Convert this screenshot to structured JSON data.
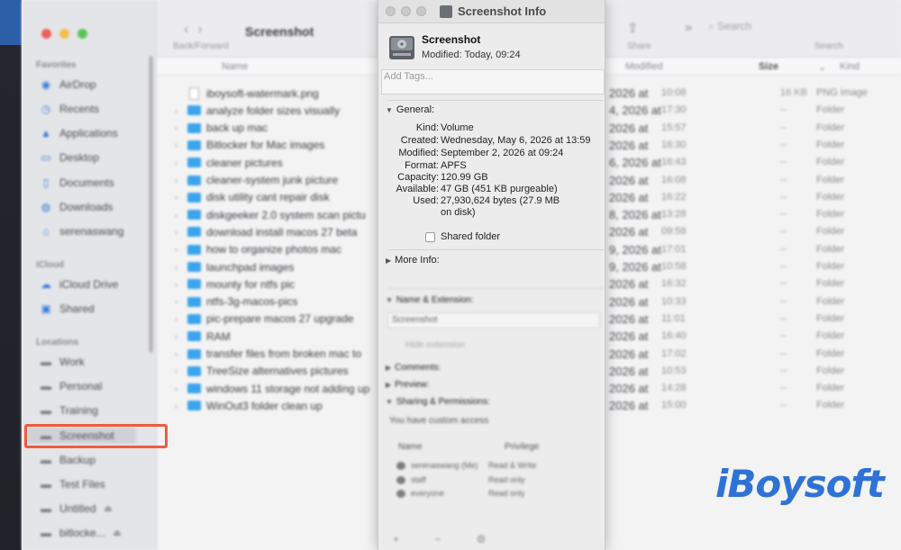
{
  "finder": {
    "sidebar": {
      "sections": [
        "Favorites",
        "iCloud",
        "Locations"
      ],
      "favorites": [
        "AirDrop",
        "Recents",
        "Applications",
        "Desktop",
        "Documents",
        "Downloads",
        "serenaswang"
      ],
      "icloud": [
        "iCloud Drive",
        "Shared"
      ],
      "locations": [
        "Work",
        "Personal",
        "Training",
        "Screenshot",
        "Backup",
        "Test Files",
        "Untitled",
        "bitlocke..."
      ]
    },
    "toolbar": {
      "title": "Screenshot",
      "back_forward_caption": "Back/Forward",
      "share_caption": "Share",
      "search_placeholder": "Search",
      "search_caption": "Search"
    },
    "columns": {
      "name": "Name",
      "modified": "Modified",
      "size": "Size",
      "kind": "Kind"
    },
    "files": [
      {
        "name": "iboysoft-watermark.png",
        "type": "file",
        "date": "2026 at",
        "time": "10:08",
        "size": "16 KB",
        "kind": "PNG image"
      },
      {
        "name": "analyze folder sizes visually",
        "type": "folder",
        "date": "4, 2026 at",
        "time": "17:30",
        "size": "--",
        "kind": "Folder"
      },
      {
        "name": "back up mac",
        "type": "folder",
        "date": "2026 at",
        "time": "15:57",
        "size": "--",
        "kind": "Folder"
      },
      {
        "name": "Bitlocker for Mac images",
        "type": "folder",
        "date": "2026 at",
        "time": "16:30",
        "size": "--",
        "kind": "Folder"
      },
      {
        "name": "cleaner pictures",
        "type": "folder",
        "date": "6, 2026 at",
        "time": "16:43",
        "size": "--",
        "kind": "Folder"
      },
      {
        "name": "cleaner-system junk picture",
        "type": "folder",
        "date": "2026 at",
        "time": "16:08",
        "size": "--",
        "kind": "Folder"
      },
      {
        "name": "disk utility cant repair disk",
        "type": "folder",
        "date": "2026 at",
        "time": "16:22",
        "size": "--",
        "kind": "Folder"
      },
      {
        "name": "diskgeeker 2.0 system scan pictu",
        "type": "folder",
        "date": "8, 2026 at",
        "time": "13:28",
        "size": "--",
        "kind": "Folder"
      },
      {
        "name": "download install macos 27 beta",
        "type": "folder",
        "date": "2026 at",
        "time": "09:58",
        "size": "--",
        "kind": "Folder"
      },
      {
        "name": "how to organize photos mac",
        "type": "folder",
        "date": "9, 2026 at",
        "time": "17:01",
        "size": "--",
        "kind": "Folder"
      },
      {
        "name": "launchpad images",
        "type": "folder",
        "date": "9, 2026 at",
        "time": "10:58",
        "size": "--",
        "kind": "Folder"
      },
      {
        "name": "mounty for ntfs pic",
        "type": "folder",
        "date": "2026 at",
        "time": "16:32",
        "size": "--",
        "kind": "Folder"
      },
      {
        "name": "ntfs-3g-macos-pics",
        "type": "folder",
        "date": "2026 at",
        "time": "10:33",
        "size": "--",
        "kind": "Folder"
      },
      {
        "name": "pic-prepare macos 27 upgrade",
        "type": "folder",
        "date": "2026 at",
        "time": "11:01",
        "size": "--",
        "kind": "Folder"
      },
      {
        "name": "RAM",
        "type": "folder",
        "date": "2026 at",
        "time": "16:40",
        "size": "--",
        "kind": "Folder"
      },
      {
        "name": "transfer files from broken mac to",
        "type": "folder",
        "date": "2026 at",
        "time": "17:02",
        "size": "--",
        "kind": "Folder"
      },
      {
        "name": "TreeSize alternatives pictures",
        "type": "folder",
        "date": "2026 at",
        "time": "10:53",
        "size": "--",
        "kind": "Folder"
      },
      {
        "name": "windows 11 storage not adding up",
        "type": "folder",
        "date": "2026 at",
        "time": "14:28",
        "size": "--",
        "kind": "Folder"
      },
      {
        "name": "WinOut3 folder clean up",
        "type": "folder",
        "date": "2026 at",
        "time": "15:00",
        "size": "--",
        "kind": "Folder"
      }
    ]
  },
  "info": {
    "window_title": "Screenshot Info",
    "name": "Screenshot",
    "modified_summary": "Modified: Today, 09:24",
    "tags_placeholder": "Add Tags...",
    "general_label": "General:",
    "general": [
      {
        "key": "Kind:",
        "value": "Volume"
      },
      {
        "key": "Created:",
        "value": "Wednesday, May 6, 2026 at 13:59"
      },
      {
        "key": "Modified:",
        "value": "September 2, 2026 at 09:24"
      },
      {
        "key": "Format:",
        "value": "APFS"
      },
      {
        "key": "Capacity:",
        "value": "120.99 GB"
      },
      {
        "key": "Available:",
        "value": "47 GB (451 KB purgeable)"
      },
      {
        "key": "Used:",
        "value": "27,930,624 bytes (27.9 MB"
      }
    ],
    "used_line2": "on disk)",
    "shared_folder_label": "Shared folder",
    "more_info_label": "More Info:",
    "name_ext_label": "Name & Extension:",
    "name_field_value": "Screenshot",
    "hide_extension_label": "Hide extension",
    "comments_label": "Comments:",
    "preview_label": "Preview:",
    "sharing_label": "Sharing & Permissions:",
    "custom_access_text": "You have custom access",
    "perm_headers": {
      "name": "Name",
      "privilege": "Privilege"
    },
    "permissions": [
      {
        "user": "serenaswang (Me)",
        "privilege": "Read & Write"
      },
      {
        "user": "staff",
        "privilege": "Read only"
      },
      {
        "user": "everyone",
        "privilege": "Read only"
      }
    ],
    "bottom_buttons": "+ − ⚙"
  },
  "watermark": {
    "text": "iBoysoft",
    "color": "#2f72d6"
  },
  "colors": {
    "highlight": "#ee5b3f",
    "folder": "#3aa4ec",
    "sidebar_icon": "#2f7ad9"
  }
}
